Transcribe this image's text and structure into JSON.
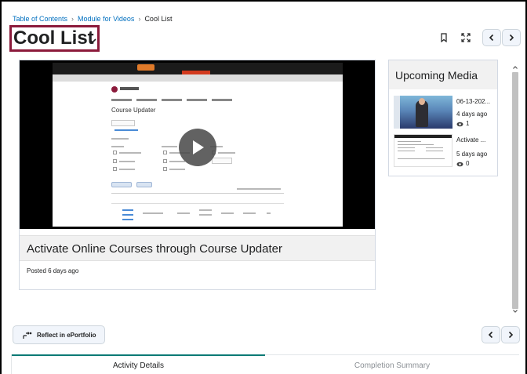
{
  "breadcrumb": {
    "items": [
      "Table of Contents",
      "Module for Videos",
      "Cool List"
    ],
    "separator": "›"
  },
  "page": {
    "title": "Cool List"
  },
  "header": {
    "icons": [
      "bookmark-icon",
      "fullscreen-icon",
      "chevron-left-icon",
      "chevron-right-icon"
    ]
  },
  "video": {
    "title": "Activate Online Courses through Course Updater",
    "posted": "Posted 6 days ago",
    "preview_heading": "Course Updater",
    "play_icon": "play-icon"
  },
  "upcoming": {
    "title": "Upcoming Media",
    "items": [
      {
        "title": "06-13-202...",
        "age": "4 days ago",
        "views": "1"
      },
      {
        "title": "Activate ...",
        "age": "5 days ago",
        "views": "0"
      }
    ]
  },
  "footer": {
    "reflect_label": "Reflect in ePortfolio",
    "tabs": [
      "Activity Details",
      "Completion Summary"
    ]
  },
  "colors": {
    "accent": "#0b7a75",
    "title_highlight": "#8b1a3b",
    "link": "#006fbf"
  }
}
